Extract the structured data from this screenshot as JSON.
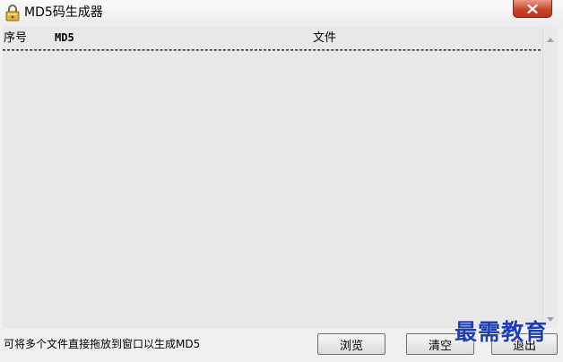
{
  "window": {
    "title": "MD5码生成器",
    "app_icon": "padlock-icon",
    "close_icon": "close-x-icon"
  },
  "list": {
    "columns": {
      "index": "序号",
      "md5": "MD5",
      "file": "文件"
    },
    "rows": []
  },
  "scrollbar": {
    "up_icon": "scroll-up-arrow-icon",
    "down_icon": "scroll-down-arrow-icon"
  },
  "footer": {
    "hint": "可将多个文件直接拖放到窗口以生成MD5",
    "buttons": {
      "browse": "浏览",
      "clear": "清空",
      "exit": "退出"
    }
  },
  "watermark": "最需教育",
  "colors": {
    "close_button": "#c9462c",
    "watermark": "#1e3fae"
  }
}
